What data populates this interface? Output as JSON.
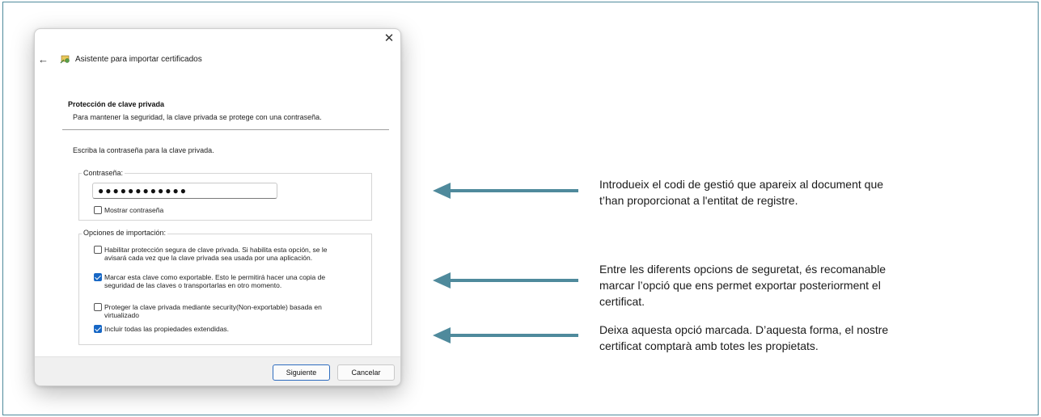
{
  "dialog": {
    "title": "Asistente para importar certificados",
    "section_heading": "Protección de clave privada",
    "section_desc": "Para mantener la seguridad, la clave privada se protege con una contraseña.",
    "prompt": "Escriba la contraseña para la clave privada.",
    "password_group": {
      "label": "Contraseña:",
      "value": "●●●●●●●●●●●●",
      "show_password_label": "Mostrar contraseña"
    },
    "import_options": {
      "label": "Opciones de importación:",
      "options": [
        {
          "line1": "Habilitar protección segura de clave privada. Si habilita esta opción, se le",
          "line2": "avisará cada vez que la clave privada sea usada por una aplicación.",
          "checked": false
        },
        {
          "line1": "Marcar esta clave como exportable. Esto le permitirá hacer una copia de",
          "line2": "seguridad de las claves o transportarlas en otro momento.",
          "checked": true
        },
        {
          "line1": "Proteger la clave privada mediante security(Non-exportable) basada en",
          "line2": "virtualizado",
          "checked": false
        },
        {
          "line1": "Incluir todas las propiedades extendidas.",
          "line2": "",
          "checked": true
        }
      ]
    },
    "buttons": {
      "next": "Siguiente",
      "cancel": "Cancelar"
    }
  },
  "annotations": [
    {
      "line1": "Introdueix el codi de gestió que apareix al document que",
      "line2": "t’han proporcionat a l'entitat de registre.",
      "line3": ""
    },
    {
      "line1": "Entre les diferents opcions de seguretat, és recomanable",
      "line2": "marcar l’opció que ens permet exportar posteriorment el",
      "line3": "certificat."
    },
    {
      "line1": "Deixa aquesta opció marcada. D’aquesta forma, el nostre",
      "line2": "certificat comptarà amb totes les propietats.",
      "line3": ""
    }
  ],
  "colors": {
    "arrow": "#4f8a9c",
    "checkbox_checked": "#1767c5",
    "frame_border": "#4f8a9c"
  },
  "icons": {
    "close": "close-icon",
    "back": "back-arrow-icon",
    "wizard": "certificate-wizard-icon"
  }
}
